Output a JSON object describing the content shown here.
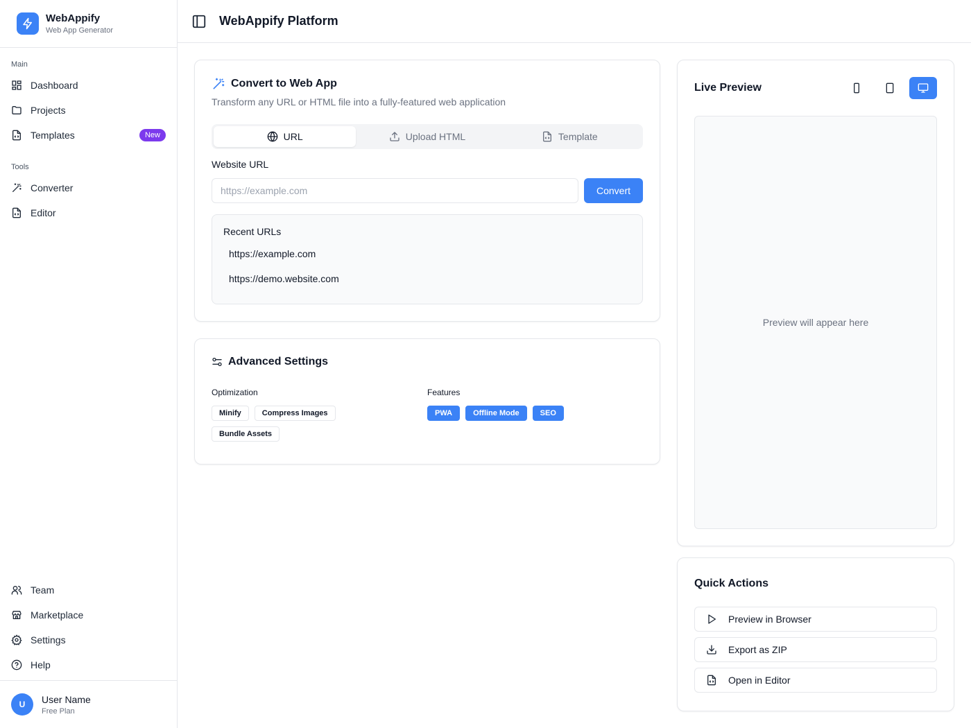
{
  "brand": {
    "name": "WebAppify",
    "subtitle": "Web App Generator"
  },
  "sidebar": {
    "groups": [
      {
        "label": "Main",
        "items": [
          {
            "label": "Dashboard",
            "icon": "dashboard-icon"
          },
          {
            "label": "Projects",
            "icon": "folder-icon"
          },
          {
            "label": "Templates",
            "icon": "file-code-icon",
            "badge": "New"
          }
        ]
      },
      {
        "label": "Tools",
        "items": [
          {
            "label": "Converter",
            "icon": "wand-icon"
          },
          {
            "label": "Editor",
            "icon": "file-code-icon"
          }
        ]
      }
    ],
    "bottom_items": [
      {
        "label": "Team",
        "icon": "users-icon"
      },
      {
        "label": "Marketplace",
        "icon": "store-icon"
      },
      {
        "label": "Settings",
        "icon": "gear-icon"
      },
      {
        "label": "Help",
        "icon": "help-circle-icon"
      }
    ],
    "user": {
      "initial": "U",
      "name": "User Name",
      "plan": "Free Plan"
    }
  },
  "header": {
    "title": "WebAppify Platform"
  },
  "convert": {
    "title": "Convert to Web App",
    "description": "Transform any URL or HTML file into a fully-featured web application",
    "tabs": [
      {
        "label": "URL",
        "active": true
      },
      {
        "label": "Upload HTML",
        "active": false
      },
      {
        "label": "Template",
        "active": false
      }
    ],
    "url_label": "Website URL",
    "url_placeholder": "https://example.com",
    "convert_button": "Convert",
    "recent_title": "Recent URLs",
    "recent_urls": [
      "https://example.com",
      "https://demo.website.com"
    ]
  },
  "advanced": {
    "title": "Advanced Settings",
    "optimization_label": "Optimization",
    "optimization_chips": [
      "Minify",
      "Compress Images",
      "Bundle Assets"
    ],
    "features_label": "Features",
    "feature_chips": [
      "PWA",
      "Offline Mode",
      "SEO"
    ]
  },
  "preview": {
    "title": "Live Preview",
    "devices": [
      "mobile",
      "tablet",
      "desktop"
    ],
    "active_device": "desktop",
    "placeholder": "Preview will appear here"
  },
  "quick_actions": {
    "title": "Quick Actions",
    "items": [
      {
        "label": "Preview in Browser",
        "icon": "play-icon"
      },
      {
        "label": "Export as ZIP",
        "icon": "download-icon"
      },
      {
        "label": "Open in Editor",
        "icon": "file-code-icon"
      }
    ]
  },
  "colors": {
    "accent": "#3b82f6",
    "badge": "#7c3aed",
    "border": "#e5e7eb",
    "muted_text": "#6b7280"
  }
}
